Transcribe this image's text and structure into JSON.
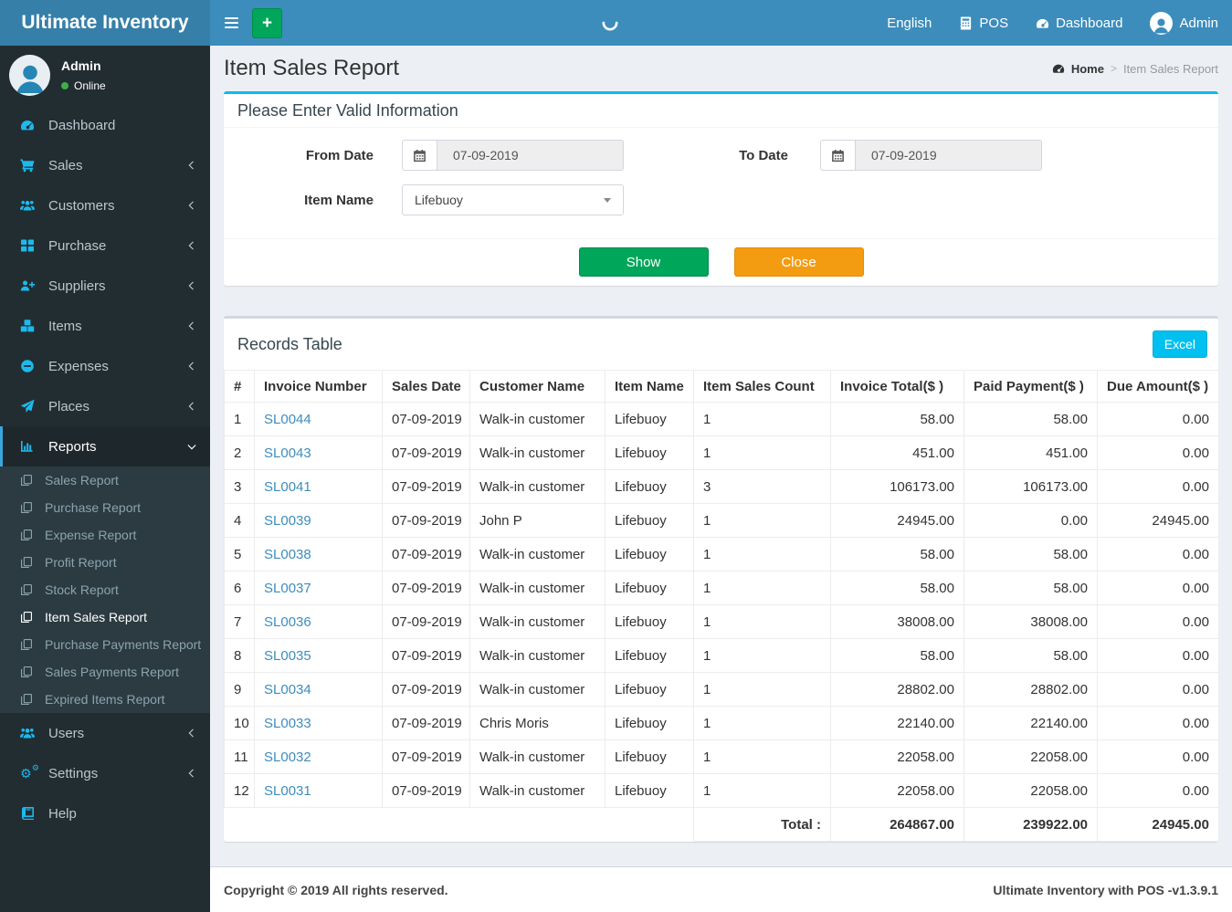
{
  "brand": "Ultimate Inventory",
  "navbar": {
    "language": "English",
    "pos": "POS",
    "dashboard": "Dashboard",
    "user": "Admin"
  },
  "user_panel": {
    "name": "Admin",
    "status": "Online"
  },
  "sidebar": {
    "items": [
      {
        "label": "Dashboard",
        "icon": "dashboard-icon",
        "arrow": "none"
      },
      {
        "label": "Sales",
        "icon": "cart-icon",
        "arrow": "left"
      },
      {
        "label": "Customers",
        "icon": "users-icon",
        "arrow": "left"
      },
      {
        "label": "Purchase",
        "icon": "grid-icon",
        "arrow": "left"
      },
      {
        "label": "Suppliers",
        "icon": "user-plus-icon",
        "arrow": "left"
      },
      {
        "label": "Items",
        "icon": "cubes-icon",
        "arrow": "left"
      },
      {
        "label": "Expenses",
        "icon": "minus-circle-icon",
        "arrow": "left"
      },
      {
        "label": "Places",
        "icon": "paper-plane-icon",
        "arrow": "left"
      },
      {
        "label": "Reports",
        "icon": "bar-chart-icon",
        "arrow": "down",
        "active": true,
        "submenu": [
          {
            "label": "Sales Report"
          },
          {
            "label": "Purchase Report"
          },
          {
            "label": "Expense Report"
          },
          {
            "label": "Profit Report"
          },
          {
            "label": "Stock Report"
          },
          {
            "label": "Item Sales Report",
            "active": true
          },
          {
            "label": "Purchase Payments Report"
          },
          {
            "label": "Sales Payments Report"
          },
          {
            "label": "Expired Items Report"
          }
        ]
      },
      {
        "label": "Users",
        "icon": "users-icon",
        "arrow": "left"
      },
      {
        "label": "Settings",
        "icon": "gears-icon",
        "arrow": "left"
      },
      {
        "label": "Help",
        "icon": "book-icon",
        "arrow": "none"
      }
    ]
  },
  "page": {
    "title": "Item Sales Report",
    "breadcrumb_home": "Home",
    "breadcrumb_sep": ">",
    "breadcrumb_current": "Item Sales Report"
  },
  "filter": {
    "title": "Please Enter Valid Information",
    "from_label": "From Date",
    "from_value": "07-09-2019",
    "to_label": "To Date",
    "to_value": "07-09-2019",
    "item_label": "Item Name",
    "item_value": "Lifebuoy",
    "show_label": "Show",
    "close_label": "Close"
  },
  "records": {
    "title": "Records Table",
    "excel_label": "Excel",
    "columns": [
      "#",
      "Invoice Number",
      "Sales Date",
      "Customer Name",
      "Item Name",
      "Item Sales Count",
      "Invoice Total($ )",
      "Paid Payment($ )",
      "Due Amount($ )"
    ],
    "rows": [
      [
        "1",
        "SL0044",
        "07-09-2019",
        "Walk-in customer",
        "Lifebuoy",
        "1",
        "58.00",
        "58.00",
        "0.00"
      ],
      [
        "2",
        "SL0043",
        "07-09-2019",
        "Walk-in customer",
        "Lifebuoy",
        "1",
        "451.00",
        "451.00",
        "0.00"
      ],
      [
        "3",
        "SL0041",
        "07-09-2019",
        "Walk-in customer",
        "Lifebuoy",
        "3",
        "106173.00",
        "106173.00",
        "0.00"
      ],
      [
        "4",
        "SL0039",
        "07-09-2019",
        "John P",
        "Lifebuoy",
        "1",
        "24945.00",
        "0.00",
        "24945.00"
      ],
      [
        "5",
        "SL0038",
        "07-09-2019",
        "Walk-in customer",
        "Lifebuoy",
        "1",
        "58.00",
        "58.00",
        "0.00"
      ],
      [
        "6",
        "SL0037",
        "07-09-2019",
        "Walk-in customer",
        "Lifebuoy",
        "1",
        "58.00",
        "58.00",
        "0.00"
      ],
      [
        "7",
        "SL0036",
        "07-09-2019",
        "Walk-in customer",
        "Lifebuoy",
        "1",
        "38008.00",
        "38008.00",
        "0.00"
      ],
      [
        "8",
        "SL0035",
        "07-09-2019",
        "Walk-in customer",
        "Lifebuoy",
        "1",
        "58.00",
        "58.00",
        "0.00"
      ],
      [
        "9",
        "SL0034",
        "07-09-2019",
        "Walk-in customer",
        "Lifebuoy",
        "1",
        "28802.00",
        "28802.00",
        "0.00"
      ],
      [
        "10",
        "SL0033",
        "07-09-2019",
        "Chris Moris",
        "Lifebuoy",
        "1",
        "22140.00",
        "22140.00",
        "0.00"
      ],
      [
        "11",
        "SL0032",
        "07-09-2019",
        "Walk-in customer",
        "Lifebuoy",
        "1",
        "22058.00",
        "22058.00",
        "0.00"
      ],
      [
        "12",
        "SL0031",
        "07-09-2019",
        "Walk-in customer",
        "Lifebuoy",
        "1",
        "22058.00",
        "22058.00",
        "0.00"
      ]
    ],
    "total_label": "Total :",
    "totals": [
      "264867.00",
      "239922.00",
      "24945.00"
    ]
  },
  "footer": {
    "copyright": "Copyright © 2019 All rights reserved.",
    "version": "Ultimate Inventory with POS -v1.3.9.1"
  },
  "colors": {
    "navbar": "#3c8dbc",
    "logo_bg": "#367fa9",
    "sidebar": "#222d32",
    "accent_cyan": "#00c0ef",
    "green": "#00a65a",
    "orange": "#f39c12",
    "link": "#3c8dbc"
  }
}
